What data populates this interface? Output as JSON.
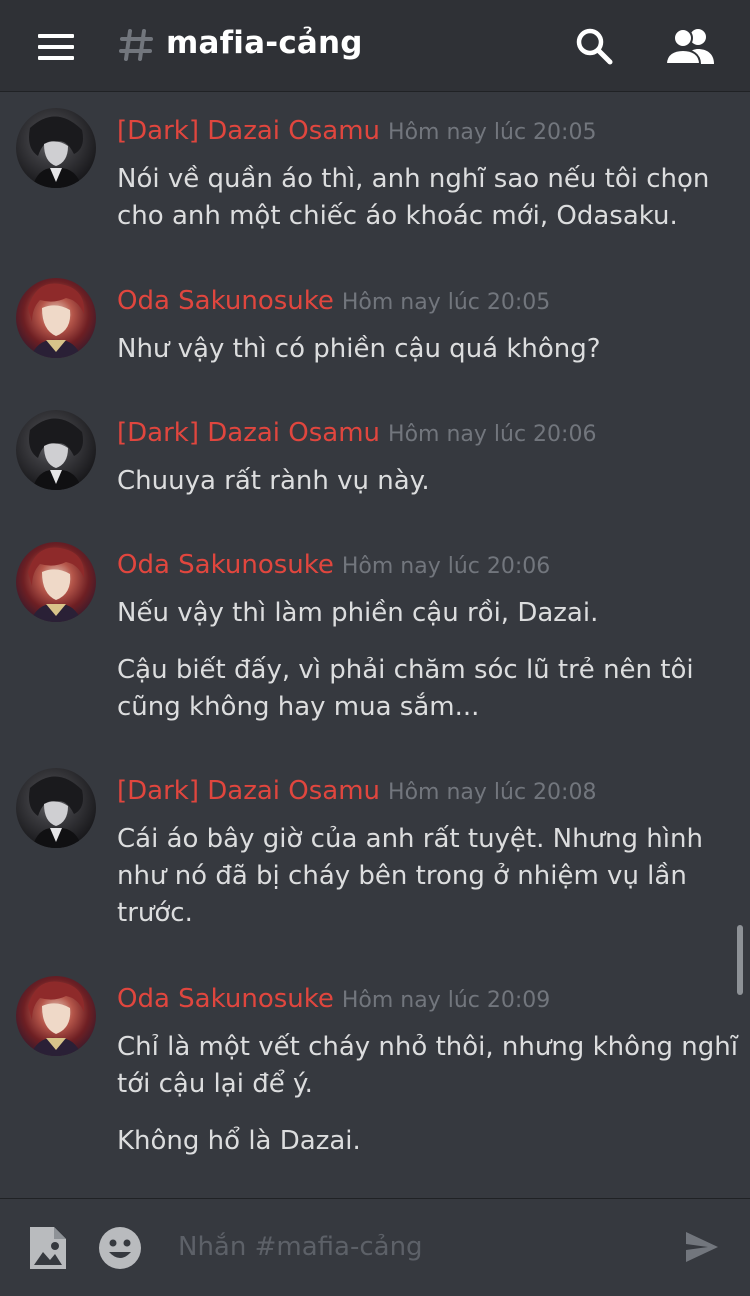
{
  "header": {
    "channel_name": "mafia-cảng",
    "icons": {
      "menu": "hamburger-menu-icon",
      "hash": "hash-icon",
      "search": "search-icon",
      "members": "members-icon"
    }
  },
  "colors": {
    "background": "#36393f",
    "topbar": "#2f3136",
    "author": "#e0463e",
    "timestamp": "#72767d",
    "text": "#dcddde"
  },
  "messages": [
    {
      "author": "[Dark] Dazai Osamu",
      "timestamp": "Hôm nay lúc 20:05",
      "lines": [
        "Nói về quần áo thì, anh nghĩ sao nếu tôi chọn",
        "cho anh một chiếc áo khoác mới, Odasaku."
      ]
    },
    {
      "author": "Oda Sakunosuke",
      "timestamp": "Hôm nay lúc 20:05",
      "lines": [
        "Như vậy thì có phiền cậu quá không?"
      ]
    },
    {
      "author": "[Dark] Dazai Osamu",
      "timestamp": "Hôm nay lúc 20:06",
      "lines": [
        "Chuuya rất rành vụ này."
      ]
    },
    {
      "author": "Oda Sakunosuke",
      "timestamp": "Hôm nay lúc 20:06",
      "lines": [
        "Nếu vậy thì làm phiền cậu rồi, Dazai.",
        "Cậu biết đấy, vì phải chăm sóc lũ trẻ nên tôi",
        "cũng không hay mua sắm..."
      ]
    },
    {
      "author": "[Dark] Dazai Osamu",
      "timestamp": "Hôm nay lúc 20:08",
      "lines": [
        "Cái áo bây giờ của anh rất tuyệt. Nhưng hình",
        "như nó đã bị cháy bên trong ở nhiệm vụ lần",
        "trước."
      ]
    },
    {
      "author": "Oda Sakunosuke",
      "timestamp": "Hôm nay lúc 20:09",
      "lines": [
        "Chỉ là một vết cháy nhỏ thôi, nhưng không nghĩ",
        "tới cậu lại để ý.",
        "Không hổ là Dazai."
      ]
    }
  ],
  "composer": {
    "placeholder": "Nhắn #mafia-cảng",
    "icons": {
      "image": "image-upload-icon",
      "emoji": "emoji-icon",
      "send": "send-icon"
    }
  }
}
